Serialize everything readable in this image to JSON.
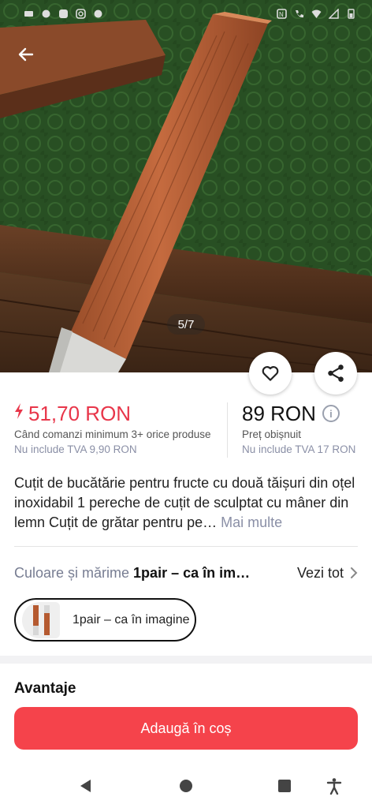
{
  "hero": {
    "image_counter": "5/7",
    "back_icon": "arrow-left-icon"
  },
  "status_bar": {
    "left_icons": [
      "signal-icon",
      "app-icon",
      "app-icon",
      "instagram-icon",
      "app-icon"
    ],
    "right_icons": [
      "nfc-icon",
      "call-icon",
      "wifi-icon",
      "no-sim-icon",
      "battery-icon"
    ]
  },
  "actions": {
    "favorite_icon": "heart-icon",
    "share_icon": "share-icon"
  },
  "price": {
    "sale": "51,70 RON",
    "sale_condition": "Când comanzi minimum 3+ orice produse",
    "sale_vat": "Nu include TVA 9,90 RON",
    "regular": "89 RON",
    "regular_label": "Preț obișnuit",
    "regular_vat": "Nu include TVA 17 RON"
  },
  "product": {
    "title": "Cuțit de bucătărie pentru fructe cu două tăișuri din oțel inoxidabil 1 pereche de cuțit de sculptat cu mâner din lemn Cuțit de grătar pentru pe…",
    "more": "Mai multe"
  },
  "variant": {
    "label": "Culoare și mărime",
    "value": "1pair – ca în im…",
    "see_all": "Vezi tot",
    "chip_label": "1pair – ca în imagine"
  },
  "section": {
    "advantages": "Avantaje"
  },
  "cta": {
    "add_to_cart": "Adaugă în coș"
  },
  "colors": {
    "accent": "#e8364a",
    "cta": "#f5434b"
  }
}
